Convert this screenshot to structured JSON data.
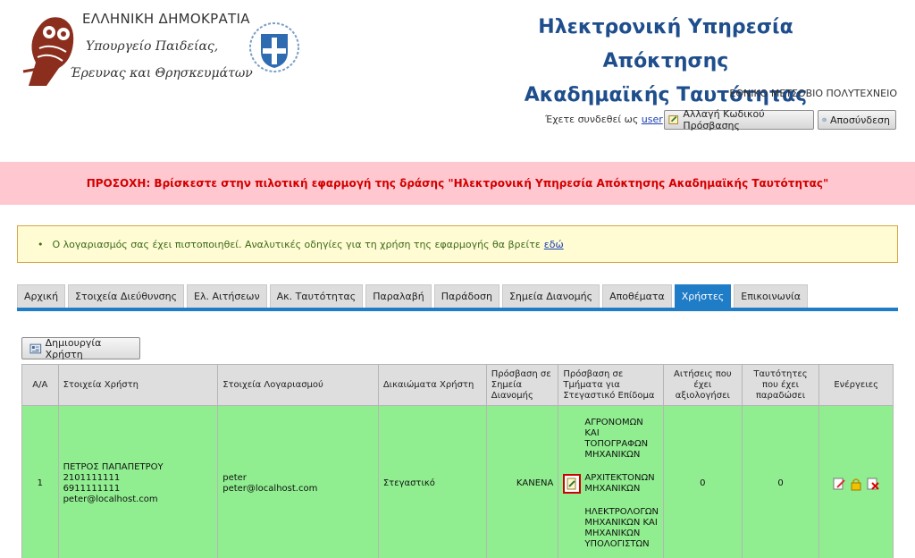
{
  "header": {
    "gov_line1": "ΕΛΛΗΝΙΚΗ ΔΗΜΟΚΡΑΤΙΑ",
    "gov_line2": "Υπουργείο Παιδείας,",
    "gov_line3": "Έρευνας και Θρησκευμάτων",
    "title_line1": "Ηλεκτρονική Υπηρεσία Απόκτησης",
    "title_line2": "Ακαδημαϊκής Ταυτότητας",
    "institution": "ΕΘΝΙΚΟ ΜΕΤΣΟΒΙΟ ΠΟΛΥΤΕΧΝΕΙΟ",
    "logged_in_prefix": "Έχετε συνδεθεί ως",
    "username": "user",
    "change_password_label": "Αλλαγή Κωδικού Πρόσβασης",
    "logout_label": "Αποσύνδεση"
  },
  "warning_text": "ΠΡΟΣΟΧΗ: Βρίσκεστε στην πιλοτική εφαρμογή της δράσης \"Ηλεκτρονική Υπηρεσία Απόκτησης Ακαδημαϊκής Ταυτότητας\"",
  "info": {
    "text": "Ο λογαριασμός σας έχει πιστοποιηθεί. Αναλυτικές οδηγίες για τη χρήση της εφαρμογής θα βρείτε",
    "link": "εδώ"
  },
  "tabs": [
    {
      "label": "Αρχική"
    },
    {
      "label": "Στοιχεία Διεύθυνσης"
    },
    {
      "label": "Ελ. Αιτήσεων"
    },
    {
      "label": "Ακ. Ταυτότητας"
    },
    {
      "label": "Παραλαβή"
    },
    {
      "label": "Παράδοση"
    },
    {
      "label": "Σημεία Διανομής"
    },
    {
      "label": "Αποθέματα"
    },
    {
      "label": "Χρήστες"
    },
    {
      "label": "Επικοινωνία"
    }
  ],
  "active_tab": "Χρήστες",
  "create_user_label": "Δημιουργία Χρήστη",
  "table": {
    "columns": {
      "aa": "Α/Α",
      "user_info": "Στοιχεία Χρήστη",
      "account_info": "Στοιχεία Λογαριασμού",
      "rights": "Δικαιώματα Χρήστη",
      "points_access": "Πρόσβαση σε Σημεία Διανομής",
      "dept_access": "Πρόσβαση σε Τμήματα για Στεγαστικό Επίδομα",
      "applications": "Αιτήσεις που έχει αξιολογήσει",
      "ids": "Ταυτότητες που έχει παραδώσει",
      "actions": "Ενέργειες"
    },
    "rows": [
      {
        "aa": "1",
        "user_name": "ΠΕΤΡΟΣ ΠΑΠΑΠΕΤΡΟΥ",
        "phone1": "2101111111",
        "phone2": "6911111111",
        "email": "peter@localhost.com",
        "account_user": "peter",
        "account_email": "peter@localhost.com",
        "rights": "Στεγαστικό",
        "points": "ΚΑΝΕΝΑ",
        "dept1": "ΑΓΡΟΝΟΜΩΝ ΚΑΙ ΤΟΠΟΓΡΑΦΩΝ ΜΗΧΑΝΙΚΩΝ",
        "dept2": "ΑΡΧΙΤΕΚΤΟΝΩΝ ΜΗΧΑΝΙΚΩΝ",
        "dept3": "ΗΛΕΚΤΡΟΛΟΓΩΝ ΜΗΧΑΝΙΚΩΝ ΚΑΙ ΜΗΧΑΝΙΚΩΝ ΥΠΟΛΟΓΙΣΤΩΝ",
        "applications": "0",
        "ids": "0"
      }
    ]
  },
  "colors": {
    "title_blue": "#1f4e8c",
    "tab_active": "#1f7cc7",
    "warning_bg": "#ffc8d0",
    "warning_text": "#d20000",
    "row_green": "#90ee90"
  }
}
